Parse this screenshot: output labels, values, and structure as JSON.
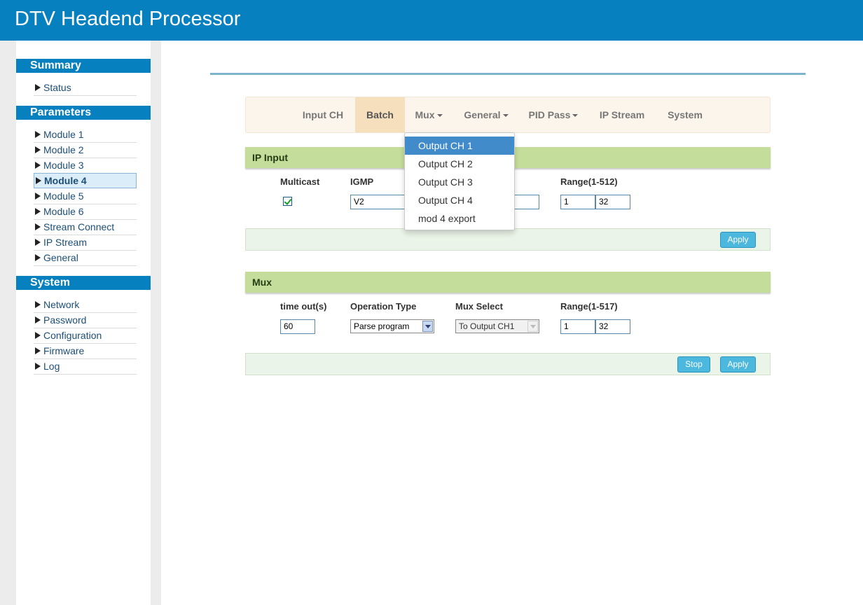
{
  "app": {
    "title": "DTV Headend Processor"
  },
  "sidebar": {
    "sections": [
      {
        "title": "Summary",
        "items": [
          "Status"
        ]
      },
      {
        "title": "Parameters",
        "items": [
          "Module 1",
          "Module 2",
          "Module 3",
          "Module 4",
          "Module 5",
          "Module 6",
          "Stream Connect",
          "IP Stream",
          "General"
        ]
      },
      {
        "title": "System",
        "items": [
          "Network",
          "Password",
          "Configuration",
          "Firmware",
          "Log"
        ]
      }
    ],
    "active_item": "Module 4"
  },
  "tabs": [
    "Input CH",
    "Batch",
    "Mux",
    "General",
    "PID Pass",
    "IP Stream",
    "System"
  ],
  "active_tab": "Batch",
  "mux_menu": {
    "items": [
      "Output CH 1",
      "Output CH 2",
      "Output CH 3",
      "Output CH 4",
      "mod 4 export"
    ],
    "highlighted": "Output CH 1"
  },
  "ip_input": {
    "title": "IP Input",
    "multicast_label": "Multicast",
    "multicast_checked": true,
    "igmp_label": "IGMP",
    "igmp_value": "V2",
    "range_label": "Range(1-512)",
    "range_start": "1",
    "range_end": "32",
    "apply_label": "Apply"
  },
  "mux": {
    "title": "Mux",
    "timeout_label": "time out(s)",
    "timeout_value": "60",
    "operation_label": "Operation Type",
    "operation_value": "Parse program",
    "muxselect_label": "Mux Select",
    "muxselect_value": "To Output CH1",
    "range_label": "Range(1-517)",
    "range_start": "1",
    "range_end": "32",
    "stop_label": "Stop",
    "apply_label": "Apply"
  }
}
